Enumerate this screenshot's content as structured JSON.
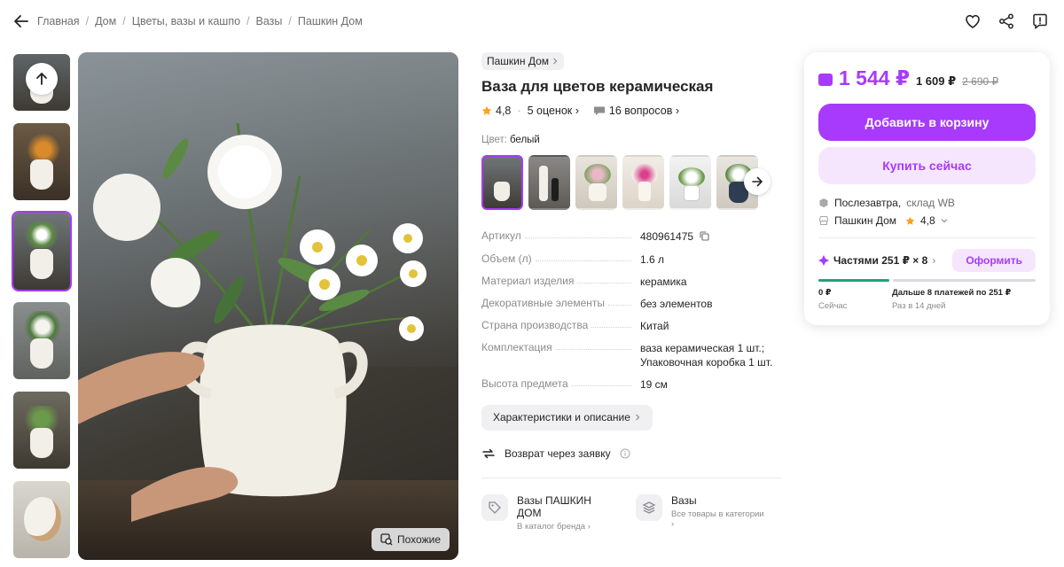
{
  "breadcrumb": [
    "Главная",
    "Дом",
    "Цветы, вазы и кашпо",
    "Вазы",
    "Пашкин Дом"
  ],
  "header_icons": [
    "heart-icon",
    "share-icon",
    "report-icon"
  ],
  "gallery": {
    "similar_label": "Похожие",
    "active_thumb_index": 2
  },
  "product": {
    "brand": "Пашкин Дом",
    "title": "Ваза для цветов керамическая",
    "rating": "4,8",
    "reviews": "5 оценок",
    "questions": "16 вопросов",
    "color_label": "Цвет:",
    "color_value": "белый",
    "specs": [
      {
        "key": "Артикул",
        "value": "480961475"
      },
      {
        "key": "Объем (л)",
        "value": "1.6 л"
      },
      {
        "key": "Материал изделия",
        "value": "керамика"
      },
      {
        "key": "Декоративные элементы",
        "value": "без элементов"
      },
      {
        "key": "Страна производства",
        "value": "Китай"
      },
      {
        "key": "Комплектация",
        "value": "ваза керамическая 1 шт.; Упаковочная коробка 1 шт."
      },
      {
        "key": "Высота предмета",
        "value": "19 см"
      }
    ],
    "desc_button": "Характеристики и описание",
    "return_text": "Возврат через заявку",
    "links": [
      {
        "title": "Вазы ПАШКИН ДОМ",
        "subtitle": "В каталог бренда"
      },
      {
        "title": "Вазы",
        "subtitle": "Все товары в категории"
      }
    ]
  },
  "buy": {
    "price_main": "1 544 ₽",
    "price_alt": "1 609 ₽",
    "price_old": "2 690 ₽",
    "add_to_cart": "Добавить в корзину",
    "buy_now": "Купить сейчас",
    "delivery_when": "Послезавтра,",
    "delivery_where": "склад WB",
    "seller": "Пашкин Дом",
    "seller_rating": "4,8",
    "installments": "Частями 251 ₽ × 8",
    "installments_button": "Оформить",
    "plan_first_amount": "0 ₽",
    "plan_first_when": "Сейчас",
    "plan_rest": "Дальше 8 платежей по 251 ₽",
    "plan_rest_when": "Раз в 14 дней"
  },
  "colors": {
    "accent": "#a73afd",
    "accent_light": "#f5e6fe",
    "green": "#1fa37c"
  }
}
